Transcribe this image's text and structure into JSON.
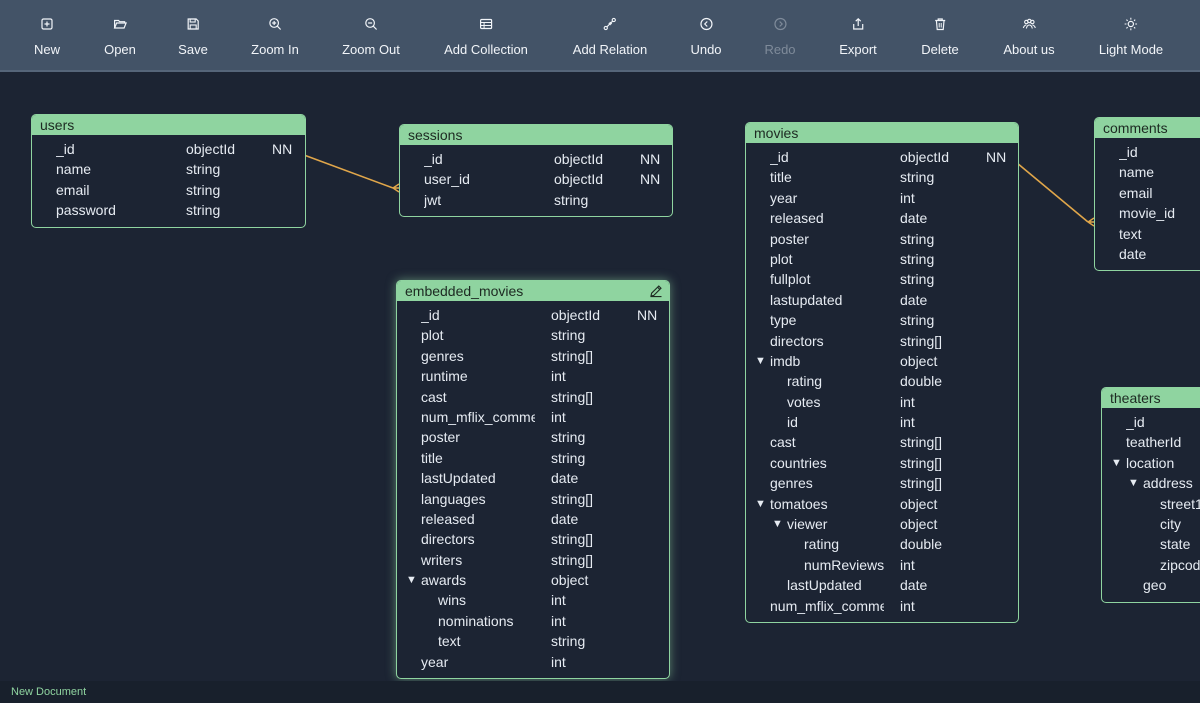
{
  "toolbar": {
    "buttons": [
      {
        "label": "New",
        "icon": "new-icon",
        "enabled": true
      },
      {
        "label": "Open",
        "icon": "folder-open-icon",
        "enabled": true
      },
      {
        "label": "Save",
        "icon": "save-icon",
        "enabled": true
      },
      {
        "label": "Zoom In",
        "icon": "zoom-in-icon",
        "enabled": true
      },
      {
        "label": "Zoom Out",
        "icon": "zoom-out-icon",
        "enabled": true
      },
      {
        "label": "Add Collection",
        "icon": "table-icon",
        "enabled": true
      },
      {
        "label": "Add Relation",
        "icon": "relation-icon",
        "enabled": true
      },
      {
        "label": "Undo",
        "icon": "undo-icon",
        "enabled": true
      },
      {
        "label": "Redo",
        "icon": "redo-icon",
        "enabled": false
      },
      {
        "label": "Export",
        "icon": "export-icon",
        "enabled": true
      },
      {
        "label": "Delete",
        "icon": "trash-icon",
        "enabled": true
      },
      {
        "label": "About us",
        "icon": "people-icon",
        "enabled": true
      },
      {
        "label": "Light Mode",
        "icon": "sun-icon",
        "enabled": true
      }
    ]
  },
  "colors": {
    "background": "#1c2433",
    "toolbar": "#435367",
    "accent": "#8fd4a0",
    "relation_line": "#e0a64a",
    "text": "#e6ebf2"
  },
  "collections": [
    {
      "name": "users",
      "fields": [
        {
          "name": "_id",
          "type": "objectId",
          "nn": "NN",
          "depth": 0
        },
        {
          "name": "name",
          "type": "string",
          "depth": 0
        },
        {
          "name": "email",
          "type": "string",
          "depth": 0
        },
        {
          "name": "password",
          "type": "string",
          "depth": 0
        }
      ]
    },
    {
      "name": "sessions",
      "fields": [
        {
          "name": "_id",
          "type": "objectId",
          "nn": "NN",
          "depth": 0
        },
        {
          "name": "user_id",
          "type": "objectId",
          "nn": "NN",
          "depth": 0
        },
        {
          "name": "jwt",
          "type": "string",
          "depth": 0
        }
      ]
    },
    {
      "name": "embedded_movies",
      "selected": true,
      "fields": [
        {
          "name": "_id",
          "type": "objectId",
          "nn": "NN",
          "depth": 0
        },
        {
          "name": "plot",
          "type": "string",
          "depth": 0
        },
        {
          "name": "genres",
          "type": "string[]",
          "depth": 0
        },
        {
          "name": "runtime",
          "type": "int",
          "depth": 0
        },
        {
          "name": "cast",
          "type": "string[]",
          "depth": 0
        },
        {
          "name": "num_mflix_comme",
          "type": "int",
          "depth": 0
        },
        {
          "name": "poster",
          "type": "string",
          "depth": 0
        },
        {
          "name": "title",
          "type": "string",
          "depth": 0
        },
        {
          "name": "lastUpdated",
          "type": "date",
          "depth": 0
        },
        {
          "name": "languages",
          "type": "string[]",
          "depth": 0
        },
        {
          "name": "released",
          "type": "date",
          "depth": 0
        },
        {
          "name": "directors",
          "type": "string[]",
          "depth": 0
        },
        {
          "name": "writers",
          "type": "string[]",
          "depth": 0
        },
        {
          "name": "awards",
          "type": "object",
          "depth": 0,
          "expanded": true
        },
        {
          "name": "wins",
          "type": "int",
          "depth": 1
        },
        {
          "name": "nominations",
          "type": "int",
          "depth": 1
        },
        {
          "name": "text",
          "type": "string",
          "depth": 1
        },
        {
          "name": "year",
          "type": "int",
          "depth": 0
        }
      ]
    },
    {
      "name": "movies",
      "fields": [
        {
          "name": "_id",
          "type": "objectId",
          "nn": "NN",
          "depth": 0
        },
        {
          "name": "title",
          "type": "string",
          "depth": 0
        },
        {
          "name": "year",
          "type": "int",
          "depth": 0
        },
        {
          "name": "released",
          "type": "date",
          "depth": 0
        },
        {
          "name": "poster",
          "type": "string",
          "depth": 0
        },
        {
          "name": "plot",
          "type": "string",
          "depth": 0
        },
        {
          "name": "fullplot",
          "type": "string",
          "depth": 0
        },
        {
          "name": "lastupdated",
          "type": "date",
          "depth": 0
        },
        {
          "name": "type",
          "type": "string",
          "depth": 0
        },
        {
          "name": "directors",
          "type": "string[]",
          "depth": 0
        },
        {
          "name": "imdb",
          "type": "object",
          "depth": 0,
          "expanded": true
        },
        {
          "name": "rating",
          "type": "double",
          "depth": 1
        },
        {
          "name": "votes",
          "type": "int",
          "depth": 1
        },
        {
          "name": "id",
          "type": "int",
          "depth": 1
        },
        {
          "name": "cast",
          "type": "string[]",
          "depth": 0
        },
        {
          "name": "countries",
          "type": "string[]",
          "depth": 0
        },
        {
          "name": "genres",
          "type": "string[]",
          "depth": 0
        },
        {
          "name": "tomatoes",
          "type": "object",
          "depth": 0,
          "expanded": true
        },
        {
          "name": "viewer",
          "type": "object",
          "depth": 1,
          "expanded": true
        },
        {
          "name": "rating",
          "type": "double",
          "depth": 2
        },
        {
          "name": "numReviews",
          "type": "int",
          "depth": 2
        },
        {
          "name": "lastUpdated",
          "type": "date",
          "depth": 1
        },
        {
          "name": "num_mflix_comme",
          "type": "int",
          "depth": 0
        }
      ]
    },
    {
      "name": "comments",
      "fields": [
        {
          "name": "_id",
          "depth": 0
        },
        {
          "name": "name",
          "depth": 0
        },
        {
          "name": "email",
          "depth": 0
        },
        {
          "name": "movie_id",
          "depth": 0
        },
        {
          "name": "text",
          "depth": 0
        },
        {
          "name": "date",
          "depth": 0
        }
      ]
    },
    {
      "name": "theaters",
      "fields": [
        {
          "name": "_id",
          "depth": 0
        },
        {
          "name": "teatherId",
          "depth": 0
        },
        {
          "name": "location",
          "depth": 0,
          "expanded": true
        },
        {
          "name": "address",
          "depth": 1,
          "expanded": true
        },
        {
          "name": "street1",
          "depth": 2
        },
        {
          "name": "city",
          "depth": 2
        },
        {
          "name": "state",
          "depth": 2
        },
        {
          "name": "zipcode",
          "depth": 2
        },
        {
          "name": "geo",
          "depth": 1
        }
      ]
    }
  ],
  "relations": [
    {
      "from": "users._id",
      "to": "sessions.user_id"
    },
    {
      "from": "movies._id",
      "to": "comments.movie_id"
    }
  ],
  "status": {
    "document_name": "New Document"
  }
}
